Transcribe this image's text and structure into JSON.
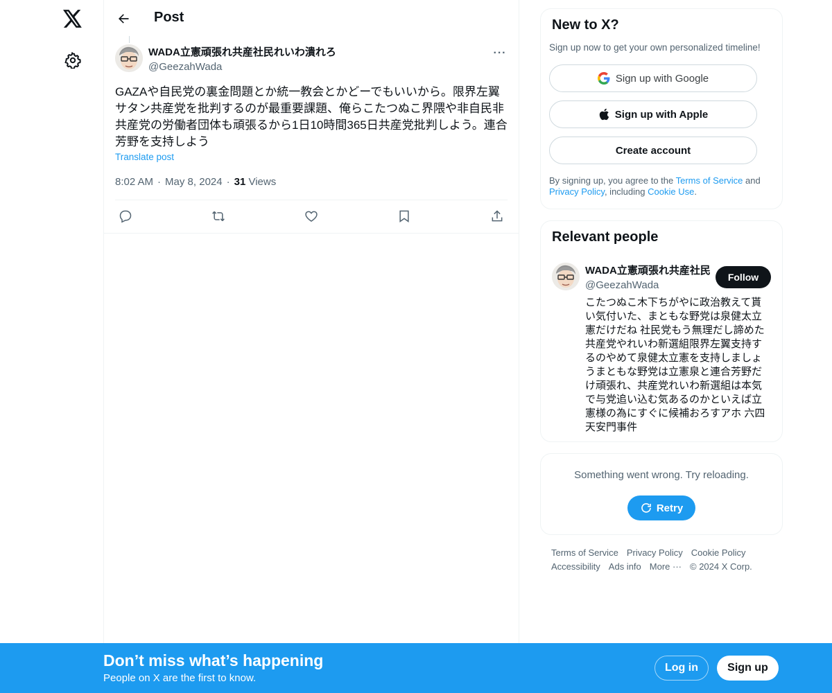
{
  "nav": {
    "logo_icon": "x-logo-icon",
    "settings_icon": "gear-icon"
  },
  "header": {
    "back_icon": "arrow-left-icon",
    "title": "Post"
  },
  "post": {
    "author_name": "WADA立憲頑張れ共産社民れいわ潰れろ",
    "author_handle": "@GeezahWada",
    "text": "GAZAや自民党の裏金問題とか統一教会とかどーでもいいから。限界左翼サタン共産党を批判するのが最重要課題、俺らこたつぬこ界隈や非自民非共産党の労働者団体も頑張るから1日10時間365日共産党批判しよう。連合芳野を支持しよう",
    "translate_label": "Translate post",
    "time": "8:02 AM",
    "date": "May 8, 2024",
    "views_count": "31",
    "views_label": "Views",
    "more_label": "···"
  },
  "actions": [
    "reply-icon",
    "repost-icon",
    "like-icon",
    "bookmark-icon",
    "share-icon"
  ],
  "sidebar": {
    "new_card": {
      "title": "New to X?",
      "subtitle": "Sign up now to get your own personalized timeline!",
      "google_label": "Sign up with Google",
      "apple_label": "Sign up with Apple",
      "create_label": "Create account",
      "terms_prefix": "By signing up, you agree to the ",
      "terms_link": "Terms of Service",
      "terms_and": " and ",
      "privacy_link": "Privacy Policy",
      "terms_including": ", including ",
      "cookie_link": "Cookie Use",
      "terms_suffix": "."
    },
    "people_card": {
      "title": "Relevant people",
      "name": "WADA立憲頑張れ共産社民",
      "handle": "@GeezahWada",
      "follow_label": "Follow",
      "bio": "こたつぬこ木下ちがやに政治教えて貰い気付いた、まともな野党は泉健太立憲だけだね 社民党もう無理だし諦めた共産党やれいわ新選組限界左翼支持するのやめて泉健太立憲を支持しましょうまともな野党は立憲泉と連合芳野だけ頑張れ、共産党れいわ新選組は本気で与党追い込む気あるのかといえば立憲様の為にすぐに候補おろすアホ 六四天安門事件"
    },
    "error_card": {
      "message": "Something went wrong. Try reloading.",
      "retry_label": "Retry"
    },
    "footer": [
      "Terms of Service",
      "Privacy Policy",
      "Cookie Policy",
      "Accessibility",
      "Ads info",
      "More ···",
      "© 2024 X Corp."
    ]
  },
  "bottom_bar": {
    "title": "Don’t miss what’s happening",
    "subtitle": "People on X are the first to know.",
    "login_label": "Log in",
    "signup_label": "Sign up"
  },
  "colors": {
    "accent": "#1d9bf0",
    "text": "#0f1419",
    "muted": "#536471",
    "border": "#eff3f4"
  }
}
